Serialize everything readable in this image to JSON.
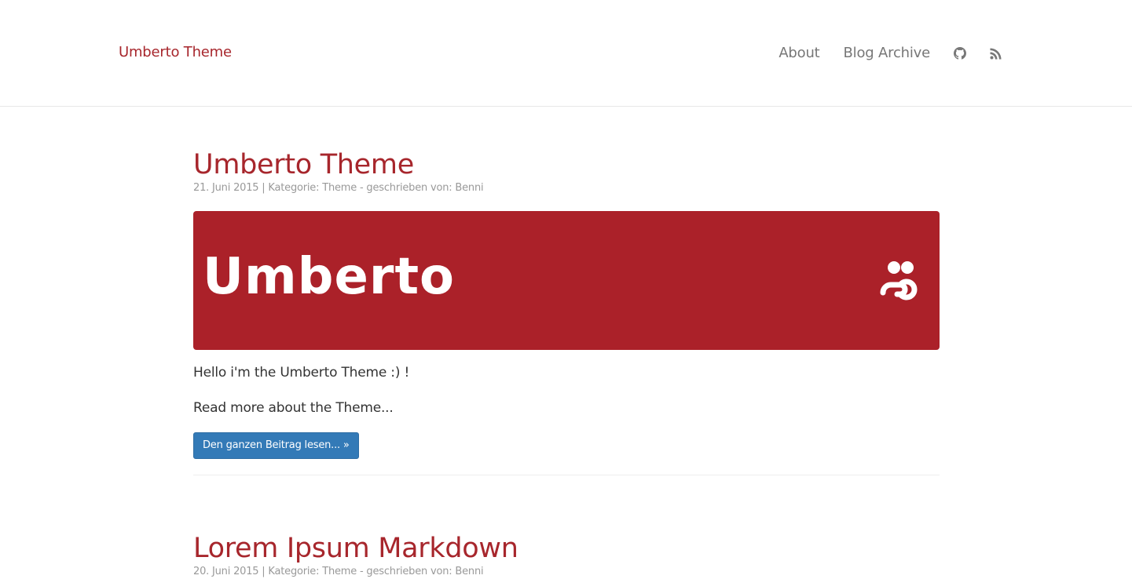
{
  "navbar": {
    "brand": "Umberto Theme",
    "links": [
      "About",
      "Blog Archive"
    ],
    "icons": [
      "github-icon",
      "rss-icon"
    ]
  },
  "posts": [
    {
      "title": "Umberto Theme",
      "meta": "21. Juni 2015 | Kategorie: Theme - geschrieben von: Benni",
      "hero_text": "Umberto",
      "paragraphs": [
        "Hello i'm the Umberto Theme :) !",
        "Read more about the Theme..."
      ],
      "button": "Den ganzen Beitrag lesen... »"
    },
    {
      "title": "Lorem Ipsum Markdown",
      "meta": "20. Juni 2015 | Kategorie: Theme - geschrieben von: Benni"
    }
  ],
  "colors": {
    "accent": "#a7262c",
    "hero_bg": "#ab2129",
    "button": "#337ab7",
    "muted": "#999999"
  }
}
